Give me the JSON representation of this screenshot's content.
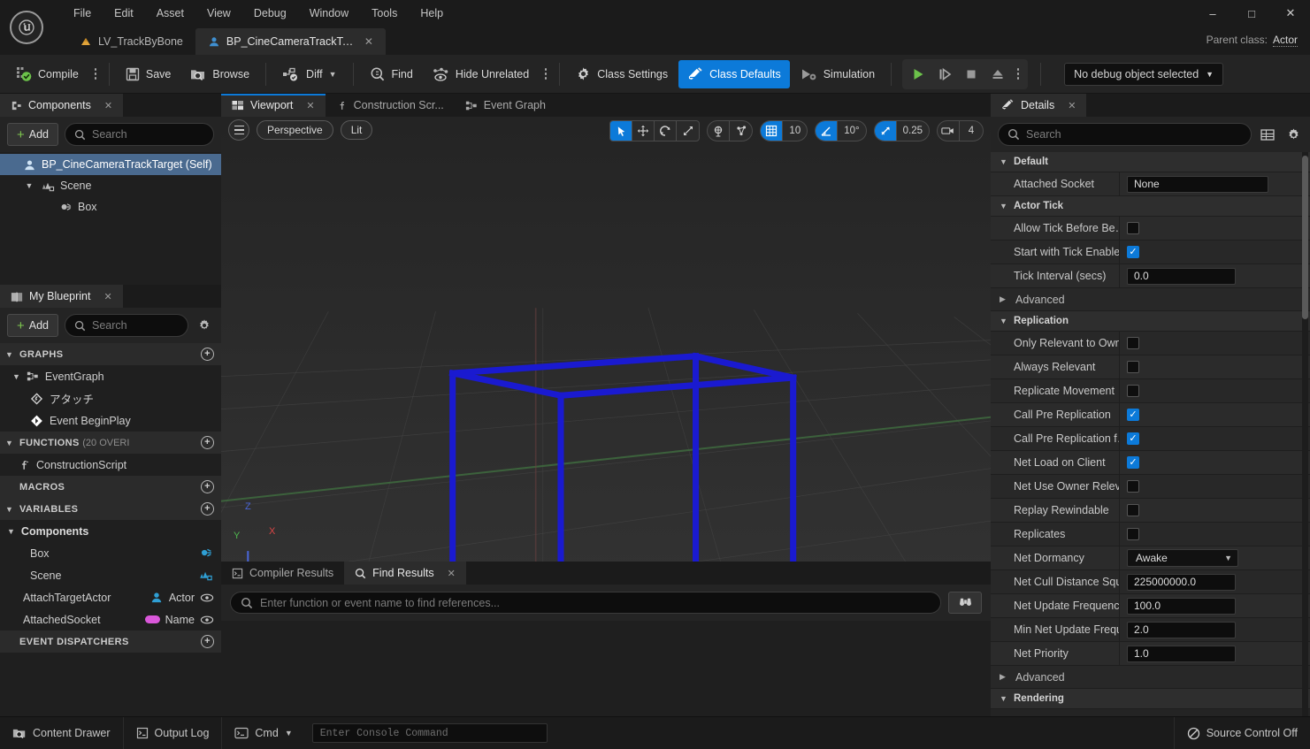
{
  "window": {
    "logo_glyph": "U",
    "minimize": "–",
    "maximize": "□",
    "close": "✕",
    "parent_class_label": "Parent class:",
    "parent_class_value": "Actor"
  },
  "menu": {
    "items": [
      "File",
      "Edit",
      "Asset",
      "View",
      "Debug",
      "Window",
      "Tools",
      "Help"
    ]
  },
  "doc_tabs": [
    {
      "label": "LV_TrackByBone",
      "icon": "level-icon",
      "active": false,
      "closable": false
    },
    {
      "label": "BP_CineCameraTrackTa...",
      "icon": "blueprint-actor-icon",
      "active": true,
      "closable": true
    }
  ],
  "toolbar": {
    "compile": "Compile",
    "save": "Save",
    "browse": "Browse",
    "diff": "Diff",
    "find": "Find",
    "hide_unrelated": "Hide Unrelated",
    "class_settings": "Class Settings",
    "class_defaults": "Class Defaults",
    "simulation": "Simulation",
    "debug_object": "No debug object selected",
    "accent_color": "#0c7ad9"
  },
  "components_panel": {
    "tab_label": "Components",
    "add_label": "Add",
    "search_placeholder": "Search",
    "search_value": "",
    "tree": [
      {
        "label": "BP_CineCameraTrackTarget (Self)",
        "indent": 1,
        "selected": true,
        "expander": "",
        "icon": "actor-icon"
      },
      {
        "label": "Scene",
        "indent": 2,
        "selected": false,
        "expander": "▼",
        "icon": "scene-component-icon"
      },
      {
        "label": "Box",
        "indent": 3,
        "selected": false,
        "expander": "",
        "icon": "box-collision-icon"
      }
    ]
  },
  "my_blueprint_panel": {
    "tab_label": "My Blueprint",
    "add_label": "Add",
    "search_placeholder": "Search",
    "search_value": "",
    "sections": [
      {
        "name": "GRAPHS",
        "extra": "",
        "expanded": true,
        "items": [
          {
            "label": "EventGraph",
            "indent": 2,
            "expander": "▼",
            "icon": "event-graph-icon"
          },
          {
            "label": "アタッチ",
            "indent": 3,
            "expander": "",
            "icon": "event-node-icon"
          },
          {
            "label": "Event BeginPlay",
            "indent": 3,
            "expander": "",
            "icon": "event-node-filled-icon"
          }
        ]
      },
      {
        "name": "FUNCTIONS",
        "extra": "(20 OVERI",
        "expanded": true,
        "items": [
          {
            "label": "ConstructionScript",
            "indent": 2,
            "expander": "",
            "icon": "function-icon"
          }
        ]
      },
      {
        "name": "MACROS",
        "extra": "",
        "expanded": false,
        "items": []
      },
      {
        "name": "VARIABLES",
        "extra": "",
        "expanded": true,
        "items": [
          {
            "label": "Components",
            "indent": 1,
            "expander": "▼",
            "icon": "category-icon"
          },
          {
            "label": "Box",
            "indent": 3,
            "expander": "",
            "icon": "box-collision-icon-blue",
            "type": ""
          },
          {
            "label": "Scene",
            "indent": 3,
            "expander": "",
            "icon": "scene-component-icon-blue",
            "type": ""
          },
          {
            "label": "AttachTargetActor",
            "indent": 2,
            "expander": "",
            "icon": "actor-icon-blue",
            "type": "Actor",
            "eye": true
          },
          {
            "label": "AttachedSocket",
            "indent": 2,
            "expander": "",
            "icon": "name-pill-icon",
            "type": "Name",
            "eye": true
          }
        ]
      },
      {
        "name": "EVENT DISPATCHERS",
        "extra": "",
        "expanded": false,
        "items": []
      }
    ]
  },
  "viewport": {
    "tabs": [
      {
        "label": "Viewport",
        "icon": "viewport-icon",
        "active": true,
        "closable": true
      },
      {
        "label": "Construction Scr...",
        "icon": "function-icon",
        "active": false,
        "closable": false
      },
      {
        "label": "Event Graph",
        "icon": "event-graph-icon",
        "active": false,
        "closable": false
      }
    ],
    "perspective": "Perspective",
    "view_mode": "Lit",
    "transform_tools": [
      "select-tool",
      "move-tool",
      "rotate-tool",
      "scale-tool"
    ],
    "active_transform_tool": "select-tool",
    "grid_snap_value": "10",
    "angle_snap_value": "10°",
    "scale_snap_value": "0.25",
    "camera_speed_value": "4",
    "axis_labels": {
      "x": "X",
      "y": "Y",
      "z": "Z"
    },
    "axis_colors": {
      "x": "#d94545",
      "y": "#4fb84f",
      "z": "#4a66d9"
    },
    "wireframe_color": "#1a1ad0",
    "background_color": "#2a2a2a"
  },
  "bottom_dock": {
    "tabs": [
      {
        "label": "Compiler Results",
        "icon": "compiler-results-icon",
        "active": false,
        "closable": false
      },
      {
        "label": "Find Results",
        "icon": "search-icon",
        "active": true,
        "closable": true
      }
    ],
    "find_placeholder": "Enter function or event name to find references...",
    "find_value": "",
    "find_button_icon": "binoculars-icon"
  },
  "details_panel": {
    "tab_label": "Details",
    "search_placeholder": "Search",
    "search_value": "",
    "header_icons": [
      "column-layout-icon",
      "gear-icon"
    ],
    "categories": [
      {
        "name": "Default",
        "expanded": true,
        "rows": [
          {
            "label": "Attached Socket",
            "kind": "text",
            "value": "None"
          }
        ]
      },
      {
        "name": "Actor Tick",
        "expanded": true,
        "rows": [
          {
            "label": "Allow Tick Before Be…",
            "kind": "checkbox",
            "checked": false
          },
          {
            "label": "Start with Tick Enabled",
            "kind": "checkbox",
            "checked": true
          },
          {
            "label": "Tick Interval (secs)",
            "kind": "number",
            "value": "0.0"
          }
        ],
        "subsections": [
          {
            "label": "Advanced",
            "expanded": false
          }
        ]
      },
      {
        "name": "Replication",
        "expanded": true,
        "rows": [
          {
            "label": "Only Relevant to Owner",
            "kind": "checkbox",
            "checked": false
          },
          {
            "label": "Always Relevant",
            "kind": "checkbox",
            "checked": false
          },
          {
            "label": "Replicate Movement",
            "kind": "checkbox",
            "checked": false
          },
          {
            "label": "Call Pre Replication",
            "kind": "checkbox",
            "checked": true
          },
          {
            "label": "Call Pre Replication f…",
            "kind": "checkbox",
            "checked": true
          },
          {
            "label": "Net Load on Client",
            "kind": "checkbox",
            "checked": true
          },
          {
            "label": "Net Use Owner Relev…",
            "kind": "checkbox",
            "checked": false
          },
          {
            "label": "Replay Rewindable",
            "kind": "checkbox",
            "checked": false
          },
          {
            "label": "Replicates",
            "kind": "checkbox",
            "checked": false
          },
          {
            "label": "Net Dormancy",
            "kind": "dropdown",
            "value": "Awake"
          },
          {
            "label": "Net Cull Distance Squ…",
            "kind": "number",
            "value": "225000000.0"
          },
          {
            "label": "Net Update Frequency",
            "kind": "number",
            "value": "100.0"
          },
          {
            "label": "Min Net Update Frequ…",
            "kind": "number",
            "value": "2.0"
          },
          {
            "label": "Net Priority",
            "kind": "number",
            "value": "1.0"
          }
        ],
        "subsections": [
          {
            "label": "Advanced",
            "expanded": false
          }
        ]
      },
      {
        "name": "Rendering",
        "expanded": true,
        "rows": [],
        "subsections": []
      }
    ]
  },
  "status_bar": {
    "content_drawer": "Content Drawer",
    "output_log": "Output Log",
    "cmd": "Cmd",
    "console_placeholder": "Enter Console Command",
    "console_value": "",
    "source_control": "Source Control Off"
  }
}
